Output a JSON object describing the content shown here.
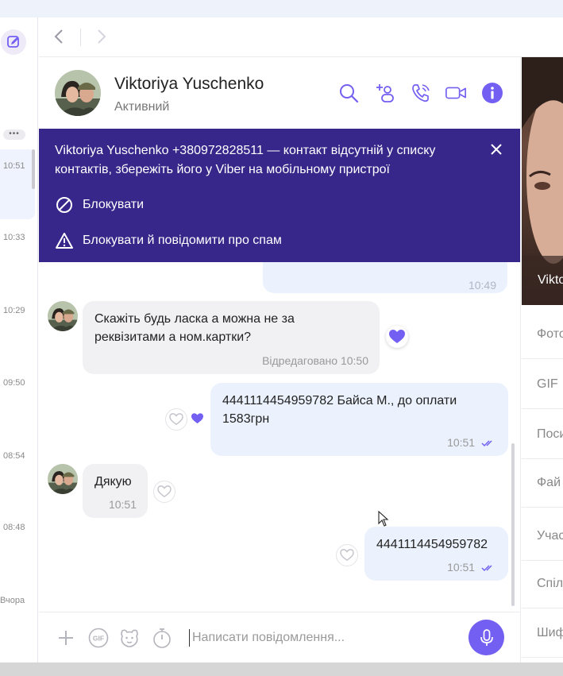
{
  "left_list": {
    "times": [
      "10:51",
      "10:33",
      "10:29",
      "09:50",
      "08:54",
      "08:48",
      "Вчора"
    ],
    "more": "•••"
  },
  "header": {
    "name": "Viktoriya Yuschenko",
    "status": "Активний"
  },
  "banner": {
    "text": "Viktoriya Yuschenko +380972828511 — контакт відсутній у списку контактів, збережіть його у Viber на мобільному пристрої",
    "block": "Блокувати",
    "block_report": "Блокувати й повідомити про спам"
  },
  "messages": [
    {
      "direction": "out",
      "time": "10:49",
      "partial": true
    },
    {
      "direction": "in",
      "text": "Скажіть будь ласка а можна не за реквізитами а ном.картки?",
      "meta": "Відредаговано 10:50",
      "reaction": "heart-filled"
    },
    {
      "direction": "out",
      "text": "4441114454959782 Байса М., до оплати 1583грн",
      "time": "10:51",
      "reaction": "heart-filled"
    },
    {
      "direction": "in",
      "text": "Дякую",
      "time": "10:51",
      "reaction": "heart-empty"
    },
    {
      "direction": "out",
      "text": "4441114454959782",
      "time": "10:51",
      "reaction": "heart-empty"
    }
  ],
  "input": {
    "placeholder": "Написати повідомлення..."
  },
  "right_panel": {
    "name_fragment": "Vikto",
    "items": [
      "Фото",
      "GIF",
      "Поси",
      "Фай",
      "Учас",
      "Спіл",
      "Шиф"
    ]
  },
  "colors": {
    "accent": "#7360f2",
    "banner_bg": "#37278a",
    "bubble_out": "#ebf2fd",
    "bubble_in": "#f1f1f3"
  }
}
